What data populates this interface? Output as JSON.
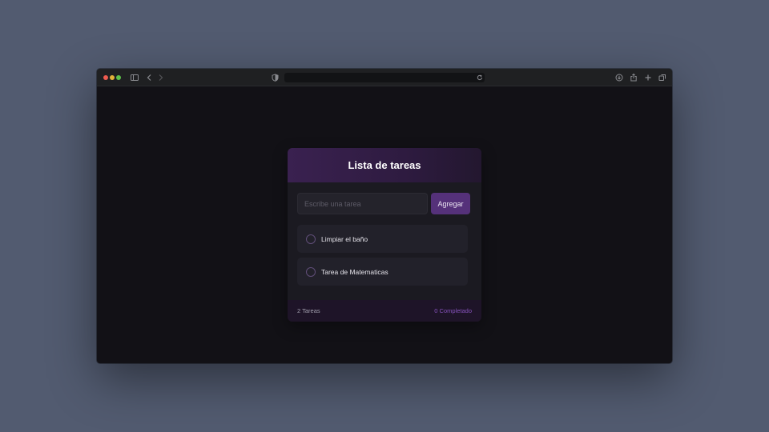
{
  "browser": {
    "icons": {
      "sidebar": "sidebar-icon",
      "back": "chevron-left-icon",
      "forward": "chevron-right-icon",
      "privacy": "shield-icon",
      "reload": "reload-icon",
      "download": "download-icon",
      "share": "share-icon",
      "new_tab": "plus-icon",
      "tabs": "tabs-overview-icon"
    },
    "url": ""
  },
  "todo": {
    "title": "Lista de tareas",
    "input_placeholder": "Escribe una tarea",
    "input_value": "",
    "add_label": "Agregar",
    "tasks": [
      {
        "label": "Limpiar el baño",
        "completed": false
      },
      {
        "label": "Tarea de Matematicas",
        "completed": false
      }
    ],
    "footer": {
      "count_text": "2 Tareas",
      "completed_text": "0 Completado"
    }
  },
  "colors": {
    "accent": "#55317a",
    "header_gradient_start": "#3a2150",
    "completed_text": "#8753bd",
    "background": "#525b70"
  }
}
